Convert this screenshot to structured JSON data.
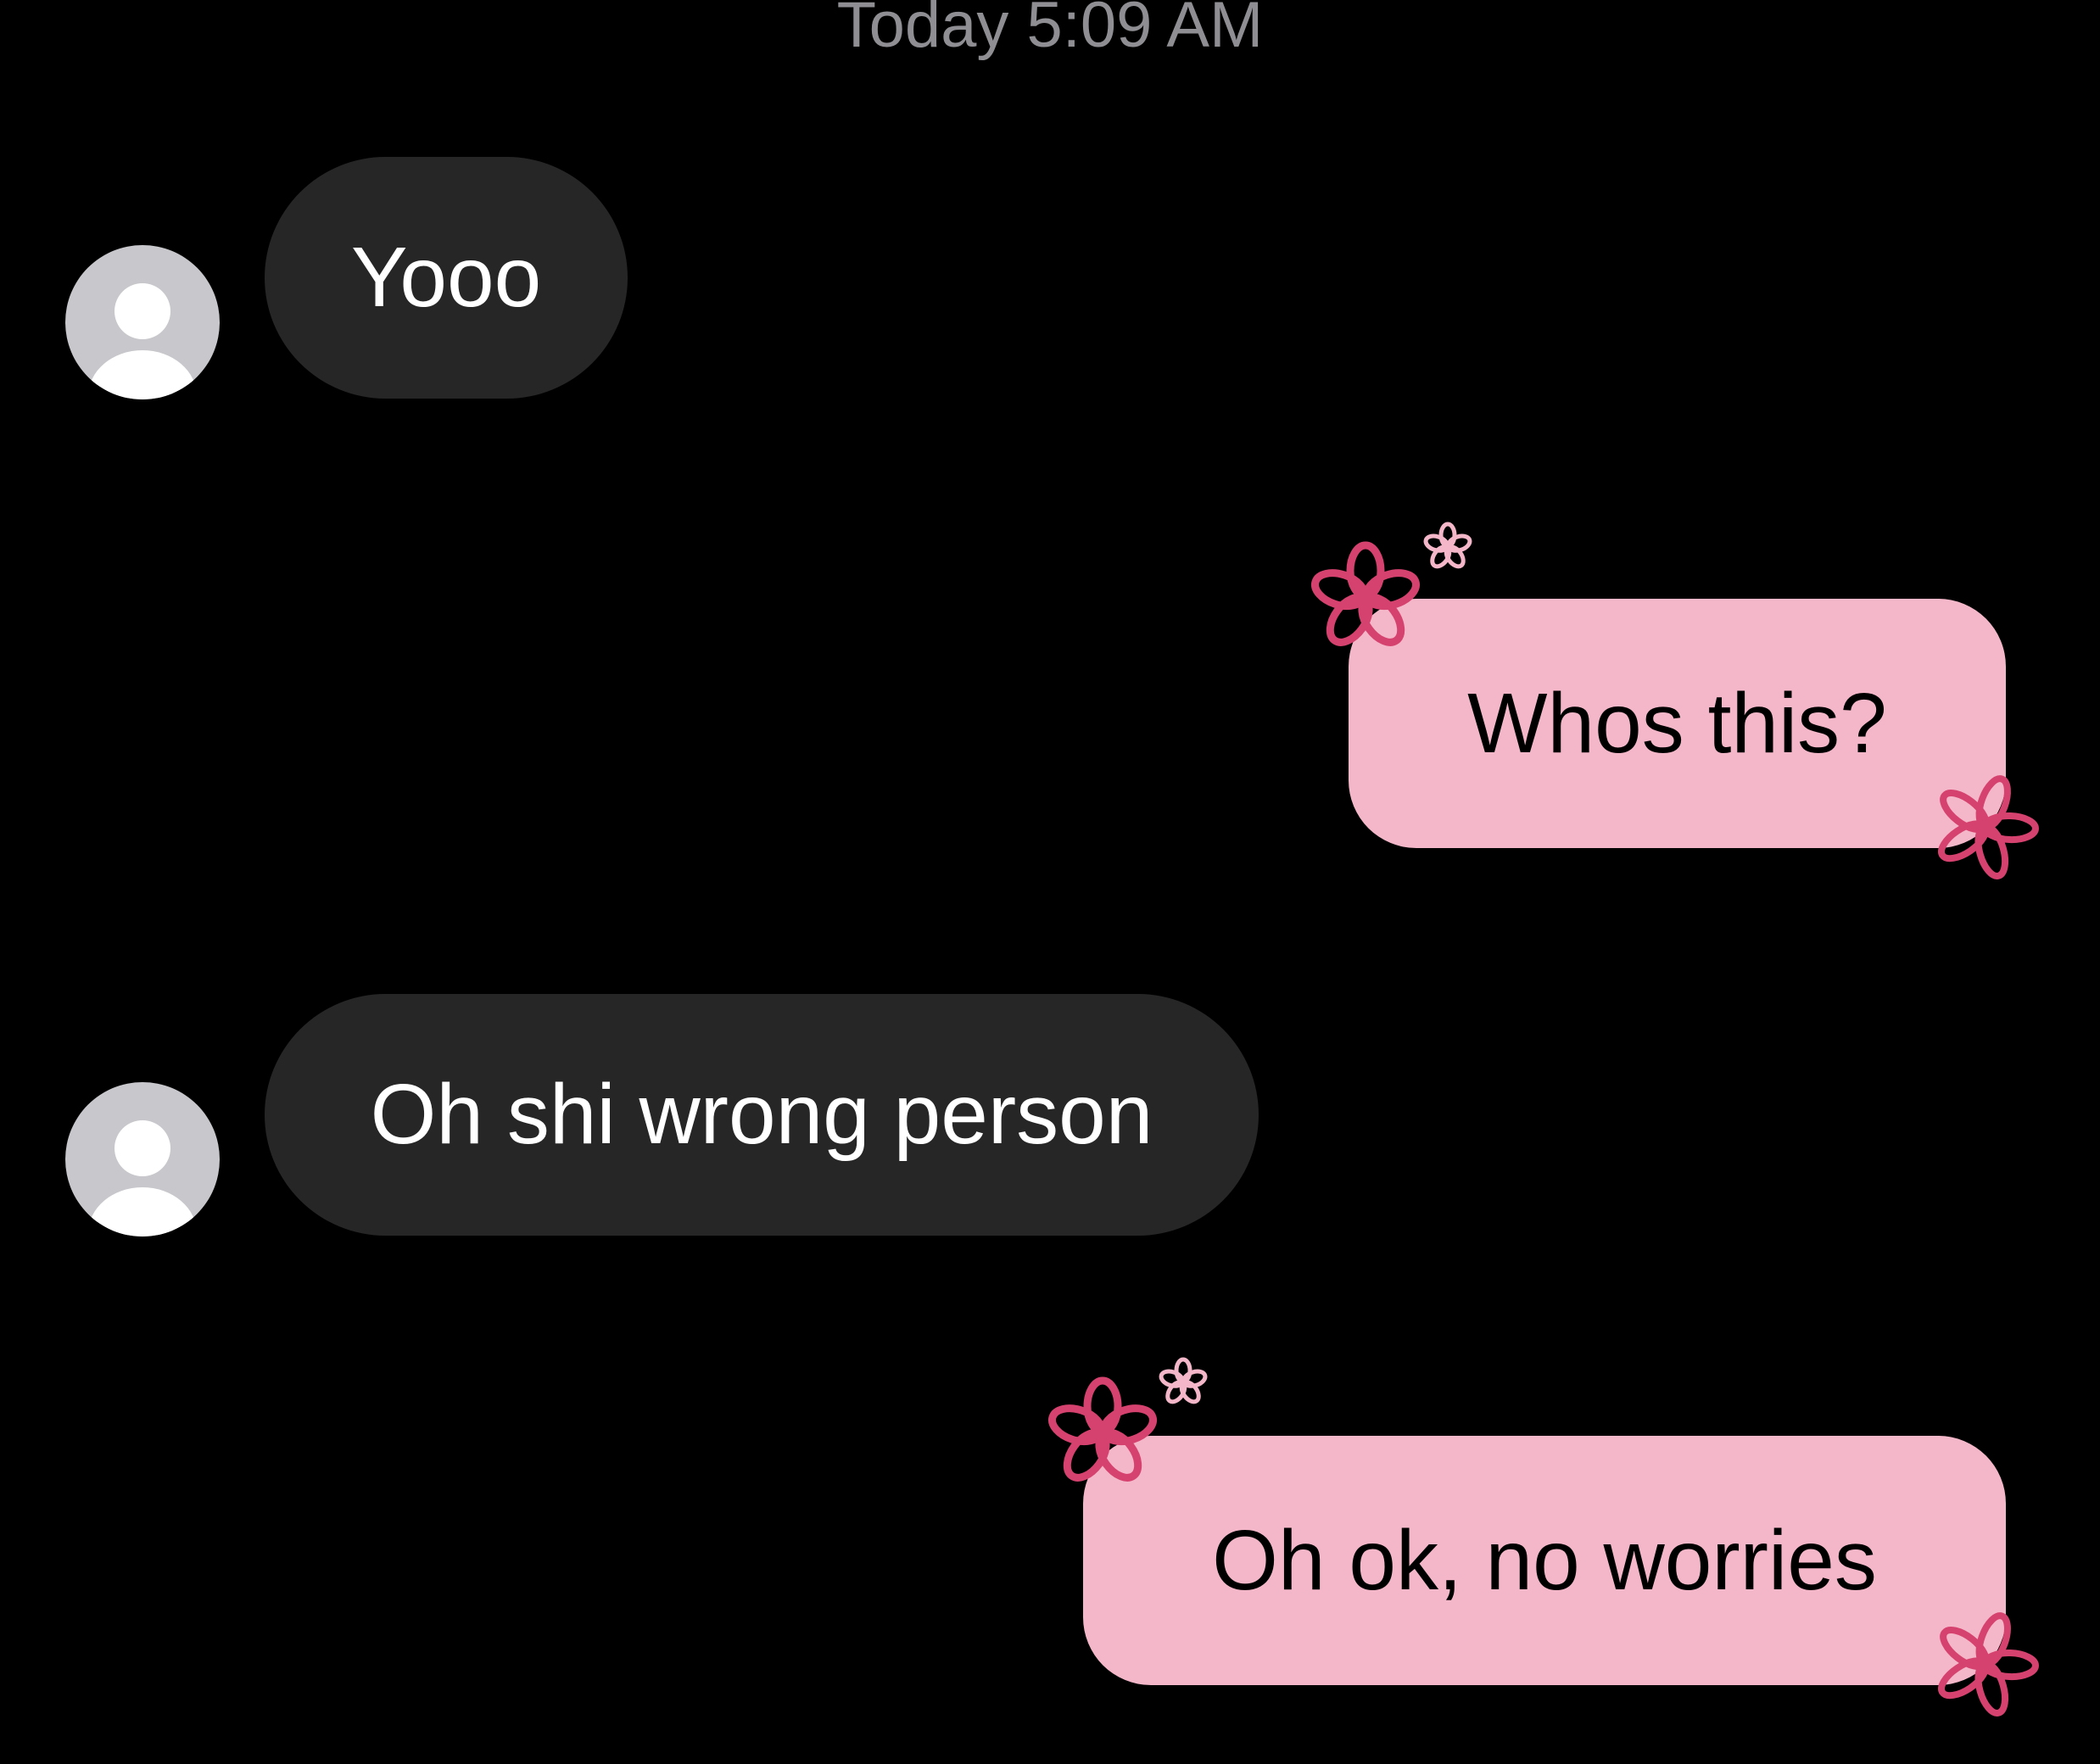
{
  "conversation": {
    "timestamp": "Today 5:09 AM",
    "messages": [
      {
        "direction": "incoming",
        "text": "Yooo",
        "avatar_icon": "default-avatar-icon"
      },
      {
        "direction": "outgoing",
        "text": "Whos this?",
        "decoration_icon": "pink-flower-icon"
      },
      {
        "direction": "incoming",
        "text": "Oh shi wrong person",
        "avatar_icon": "default-avatar-icon"
      },
      {
        "direction": "outgoing",
        "text": "Oh ok, no worries",
        "decoration_icon": "pink-flower-icon"
      }
    ]
  },
  "colors": {
    "background": "#000000",
    "incoming_bubble": "#262626",
    "outgoing_bubble": "#f4b7c9",
    "flower_accent": "#d6426f",
    "timestamp_text": "#8e8e93",
    "avatar_bg": "#c7c7cc"
  }
}
